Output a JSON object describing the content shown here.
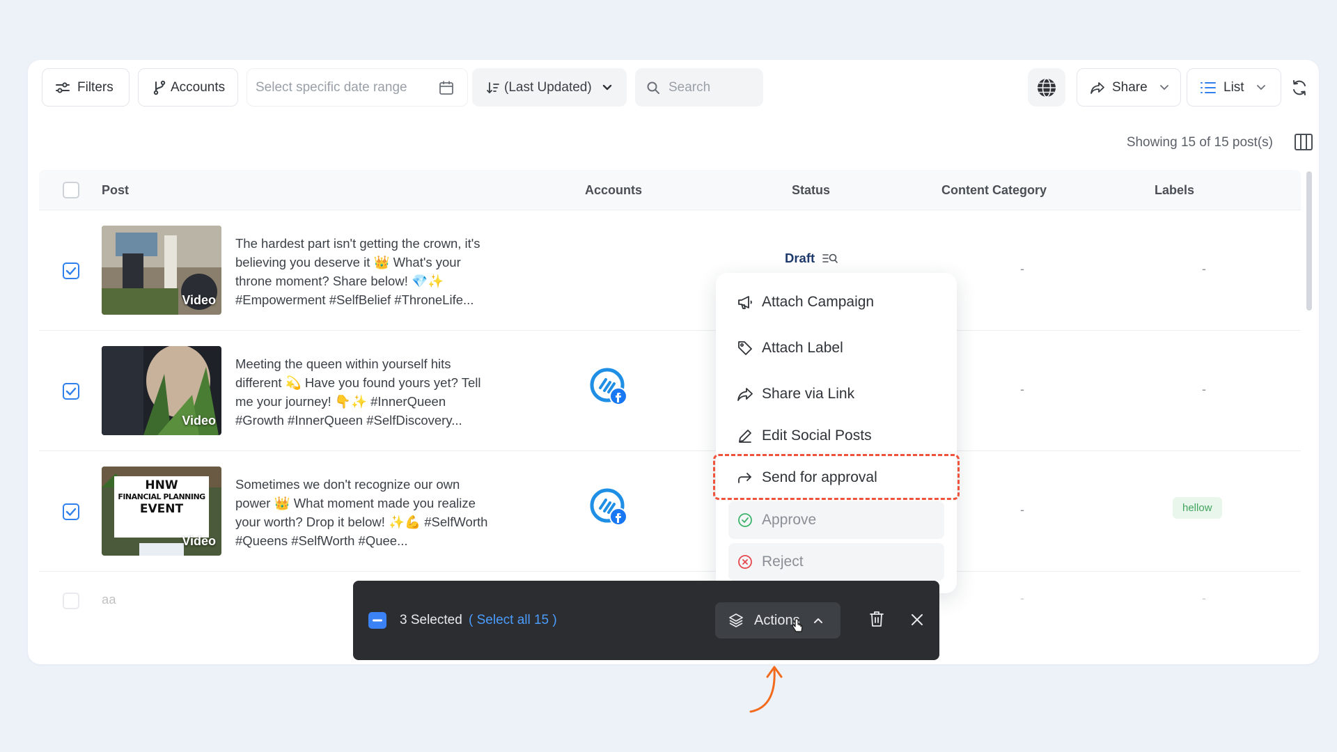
{
  "toolbar": {
    "filters_label": "Filters",
    "accounts_label": "Accounts",
    "date_placeholder": "Select specific date range",
    "sort_label": "(Last Updated)",
    "search_placeholder": "Search",
    "share_label": "Share",
    "view_label": "List"
  },
  "showing_text": "Showing 15 of 15 post(s)",
  "table": {
    "columns": [
      "Post",
      "Accounts",
      "Status",
      "Content Category",
      "Labels"
    ],
    "rows": [
      {
        "checked": true,
        "thumb_label": "Video",
        "caption": "The hardest part isn't getting the crown, it's believing you deserve it 👑 What's your throne moment? Share below! 💎✨ #Empowerment #SelfBelief #ThroneLife...",
        "status": "Draft",
        "content_category": "-",
        "label": "-"
      },
      {
        "checked": true,
        "thumb_label": "Video",
        "caption": "Meeting the queen within yourself hits different 💫 Have you found yours yet? Tell me your journey! 👇✨ #InnerQueen #Growth #InnerQueen #SelfDiscovery...",
        "content_category": "-",
        "label": "-"
      },
      {
        "checked": true,
        "thumb_label": "Video",
        "thumb_text": [
          "HNW",
          "FINANCIAL PLANNING",
          "EVENT"
        ],
        "caption": "Sometimes we don't recognize our own power 👑 What moment made you realize your worth? Drop it below! ✨💪 #SelfWorth #Queens #SelfWorth #Quee...",
        "content_category": "-",
        "label": "hellow"
      },
      {
        "checked": false,
        "caption": "aa",
        "content_category": "-",
        "label": "-"
      }
    ]
  },
  "menu": {
    "items": [
      {
        "label": "Attach Campaign",
        "icon": "megaphone-icon"
      },
      {
        "label": "Attach Label",
        "icon": "tag-icon"
      },
      {
        "label": "Share via Link",
        "icon": "share-icon"
      },
      {
        "label": "Edit Social Posts",
        "icon": "pencil-icon"
      },
      {
        "label": "Send for approval",
        "icon": "forward-arrow-icon"
      },
      {
        "label": "Approve",
        "icon": "check-circle-icon"
      },
      {
        "label": "Reject",
        "icon": "x-circle-icon"
      }
    ]
  },
  "selection_bar": {
    "selected_text": "3 Selected",
    "select_all_text": "( Select all 15 )",
    "actions_label": "Actions"
  },
  "colors": {
    "accent": "#2f80ed",
    "highlight": "#f0533c",
    "bar_bg": "#2b2d30",
    "arrow": "#f26b1d"
  }
}
